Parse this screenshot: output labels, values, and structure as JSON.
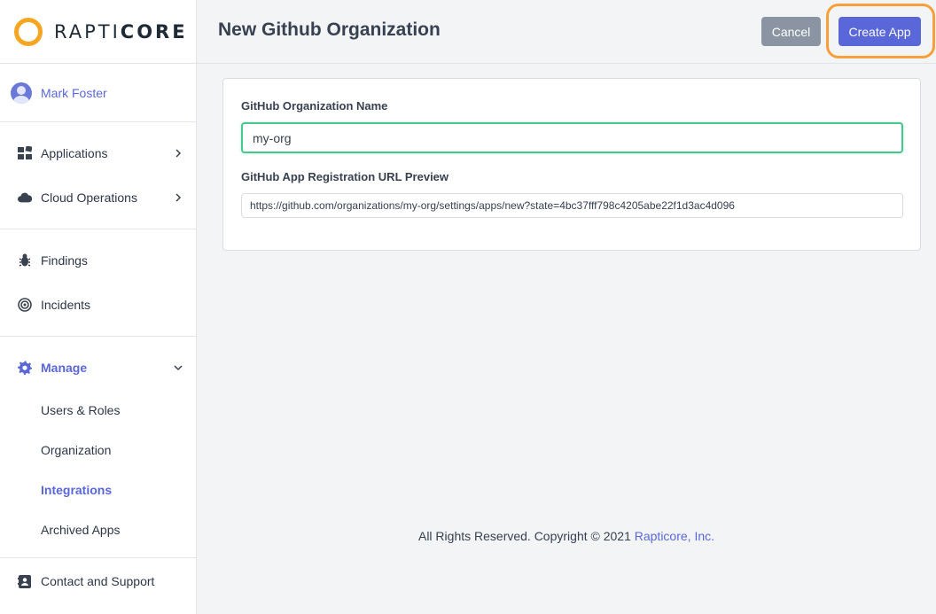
{
  "brand": {
    "name_light": "RAPTI",
    "name_bold": "CORE",
    "accent": "#f5a623"
  },
  "user": {
    "name": "Mark Foster"
  },
  "nav": {
    "applications": "Applications",
    "cloud_operations": "Cloud Operations",
    "findings": "Findings",
    "incidents": "Incidents",
    "manage": "Manage",
    "manage_items": [
      "Users & Roles",
      "Organization",
      "Integrations",
      "Archived Apps"
    ],
    "active_sub": "Integrations",
    "contact": "Contact and Support"
  },
  "header": {
    "title": "New Github Organization",
    "cancel_label": "Cancel",
    "create_label": "Create App"
  },
  "form": {
    "org_name_label": "GitHub Organization Name",
    "org_name_value": "my-org",
    "url_preview_label": "GitHub App Registration URL Preview",
    "url_preview_value": "https://github.com/organizations/my-org/settings/apps/new?state=4bc37fff798c4205abe22f1d3ac4d096"
  },
  "footer": {
    "text": "All Rights Reserved. Copyright © 2021 ",
    "link": "Rapticore, Inc."
  },
  "colors": {
    "primary": "#5a67d8",
    "cancel": "#8a94a3",
    "input_focus": "#48c78e",
    "highlight": "#f5a03a"
  }
}
